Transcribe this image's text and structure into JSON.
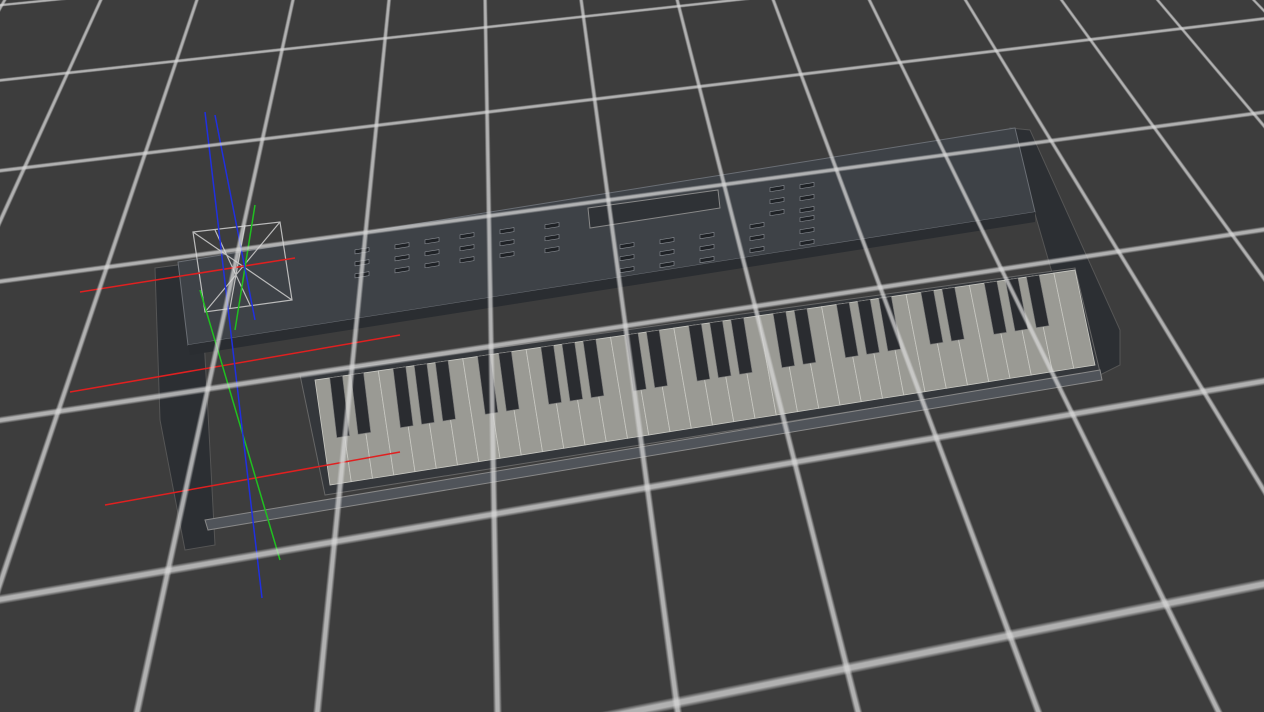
{
  "viewport": {
    "mode": "wireframe-shaded",
    "object": "keyboard-synth-model"
  },
  "colors": {
    "background": "#3d3d3d",
    "grid": "#d7d7d7",
    "body": "#3e4247",
    "key_white": "#9a9a94",
    "key_black": "#2a2c30",
    "axis_x": "#e02020",
    "axis_y": "#20c020",
    "axis_z": "#2030e0"
  },
  "keyboard": {
    "key_count": 61
  }
}
